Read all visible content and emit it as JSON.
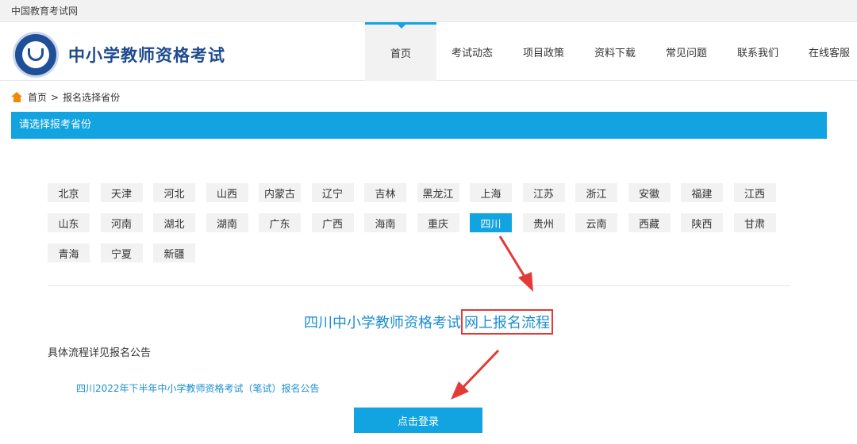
{
  "topbar": {
    "site_name": "中国教育考试网"
  },
  "header": {
    "brand": "中小学教师资格考试",
    "nav": [
      "首页",
      "考试动态",
      "项目政策",
      "资料下载",
      "常见问题",
      "联系我们",
      "在线客服"
    ]
  },
  "breadcrumb": {
    "home": "首页",
    "separator": ">",
    "current": "报名选择省份"
  },
  "section": {
    "title": "请选择报考省份"
  },
  "provinces": [
    "北京",
    "天津",
    "河北",
    "山西",
    "内蒙古",
    "辽宁",
    "吉林",
    "黑龙江",
    "上海",
    "江苏",
    "浙江",
    "安徽",
    "福建",
    "江西",
    "山东",
    "河南",
    "湖北",
    "湖南",
    "广东",
    "广西",
    "海南",
    "重庆",
    "四川",
    "贵州",
    "云南",
    "西藏",
    "陕西",
    "甘肃",
    "青海",
    "宁夏",
    "新疆"
  ],
  "selected_province": "四川",
  "flow": {
    "title_prefix": "四川中小学教师资格考试",
    "title_highlight": "网上报名流程"
  },
  "detail_text": "具体流程详见报名公告",
  "announcement": "四川2022年下半年中小学教师资格考试（笔试）报名公告",
  "login_button": "点击登录",
  "colors": {
    "accent": "#12a4e0",
    "brand": "#1d4a8f",
    "annotation": "#e53935",
    "home_icon": "#f08a00"
  }
}
